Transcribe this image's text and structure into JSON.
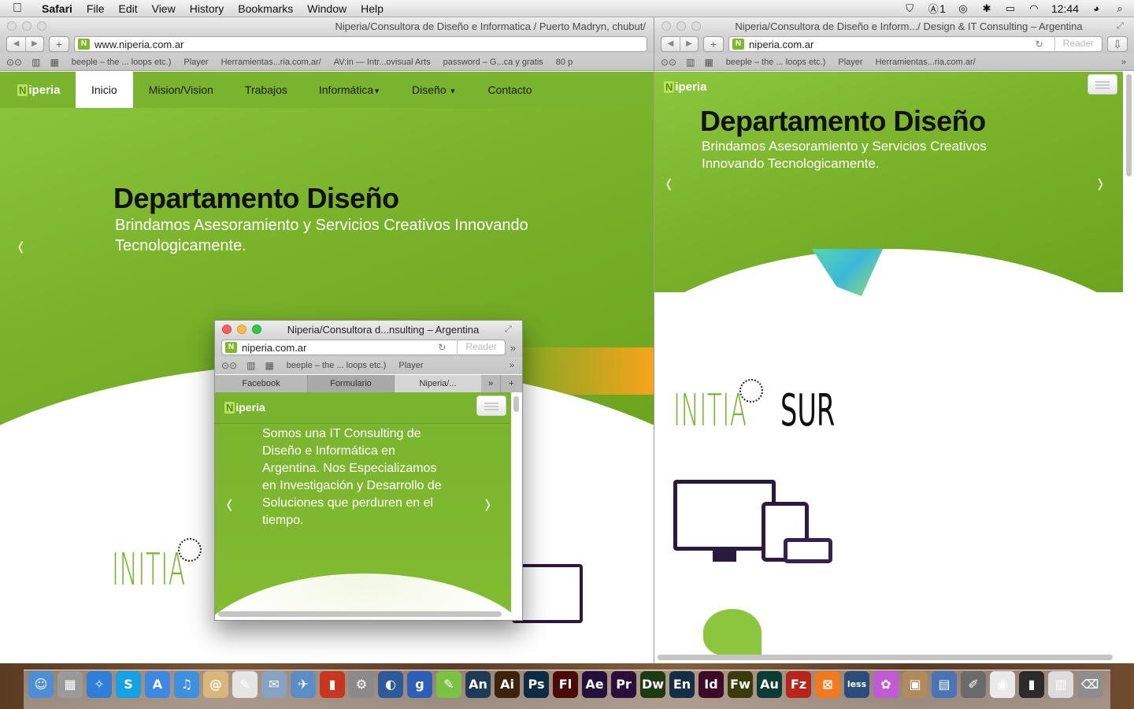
{
  "menubar": {
    "apple": "",
    "app_name": "Safari",
    "menus": [
      "File",
      "Edit",
      "View",
      "History",
      "Bookmarks",
      "Window",
      "Help"
    ],
    "adobe_count": "1",
    "clock": "12:44"
  },
  "browser_main": {
    "title": "Niperia/Consultora de Diseño e Informatica / Puerto Madryn, chubut/",
    "url": "www.niperia.com.ar",
    "bookmarks": [
      "beeple – the ... loops etc.)",
      "Player",
      "Herramientas...ria.com.ar/",
      "AV:in — Intr...ovisual Arts",
      "password – G...ca y gratis",
      "80 p"
    ]
  },
  "browser_right": {
    "title": "Niperia/Consultora de Diseño e Inform.../ Design & IT Consulting – Argentina",
    "url": "niperia.com.ar",
    "reader": "Reader",
    "bookmarks": [
      "beeple – the ... loops etc.)",
      "Player",
      "Herramientas...ria.com.ar/"
    ],
    "more": "»"
  },
  "browser_small": {
    "title": "Niperia/Consultora d...nsulting – Argentina",
    "url": "niperia.com.ar",
    "reader": "Reader",
    "bookmarks": [
      "beeple – the ... loops etc.)",
      "Player"
    ],
    "tabs": [
      "Facebook",
      "Formulario",
      "Niperia/..."
    ],
    "more": "»",
    "new_tab": "+"
  },
  "site": {
    "brand_n": "N",
    "brand_rest": "iperia",
    "nav": [
      "Inicio",
      "Mision/Vision",
      "Trabajos",
      "Informática",
      "Diseño",
      "Contacto"
    ],
    "hero_title": "Departamento Diseño",
    "hero_sub_line1": "Brindamos Asesoramiento y Servicios Creativos Innovando",
    "hero_sub_line2": "Tecnologicamente.",
    "hero_sub_right_line1": "Brindamos Asesoramiento y Servicios Creativos",
    "hero_sub_right_line2": "Innovando Tecnologicamente.",
    "small_text": [
      "Somos una IT Consulting de",
      "Diseño e Informática en",
      "Argentina. Nos Especializamos",
      "en Investigación y Desarrollo de",
      "Soluciones que perduren en el",
      "tiempo."
    ],
    "initia_logo": "INITIA",
    "sur_logo": "SUR",
    "prev": "‹",
    "next": "›"
  },
  "colors": {
    "brand_green": "#7ab32d",
    "dark_purple": "#2a1a3d"
  },
  "dock": {
    "items": [
      {
        "label": "☺",
        "color": "#4d8fd6"
      },
      {
        "label": "▦",
        "color": "#9a9a9a"
      },
      {
        "label": "✧",
        "color": "#2f7fd8"
      },
      {
        "label": "S",
        "color": "#14a2e4"
      },
      {
        "label": "A",
        "color": "#3d88e3"
      },
      {
        "label": "♫",
        "color": "#3d8fe0"
      },
      {
        "label": "@",
        "color": "#d9b67a"
      },
      {
        "label": "✎",
        "color": "#e5e5e5"
      },
      {
        "label": "✉",
        "color": "#88a3c2"
      },
      {
        "label": "✈",
        "color": "#5b8ec7"
      },
      {
        "label": "▮",
        "color": "#c9361f"
      },
      {
        "label": "⚙",
        "color": "#8a8a8a"
      },
      {
        "label": "◐",
        "color": "#2c5a9a"
      },
      {
        "label": "g",
        "color": "#2c60b8"
      },
      {
        "label": "✎",
        "color": "#7bc142"
      },
      {
        "label": "An",
        "color": "#1f3a57"
      },
      {
        "label": "Ai",
        "color": "#3b2409"
      },
      {
        "label": "Ps",
        "color": "#0c2c44"
      },
      {
        "label": "Fl",
        "color": "#4a0a0a"
      },
      {
        "label": "Ae",
        "color": "#23103d"
      },
      {
        "label": "Pr",
        "color": "#2b0e3a"
      },
      {
        "label": "Dw",
        "color": "#1c3b14"
      },
      {
        "label": "En",
        "color": "#132e46"
      },
      {
        "label": "Id",
        "color": "#3c0a25"
      },
      {
        "label": "Fw",
        "color": "#3a3b0a"
      },
      {
        "label": "Au",
        "color": "#0a3b36"
      },
      {
        "label": "Fz",
        "color": "#b8231b"
      },
      {
        "label": "⊠",
        "color": "#f17a1f"
      },
      {
        "label": "less",
        "color": "#2c4c7c"
      },
      {
        "label": "✿",
        "color": "#c25ad6"
      },
      {
        "label": "▣",
        "color": "#b08b5d"
      },
      {
        "label": "▤",
        "color": "#4a74b8"
      },
      {
        "label": "✐",
        "color": "#6b6b6b"
      },
      {
        "label": "◉",
        "color": "#e9e9e9"
      },
      {
        "label": "▮",
        "color": "#2b2b2b"
      },
      {
        "label": "▥",
        "color": "#dcdcdc"
      },
      {
        "label": "⌫",
        "color": "#8d8d8d"
      }
    ]
  }
}
